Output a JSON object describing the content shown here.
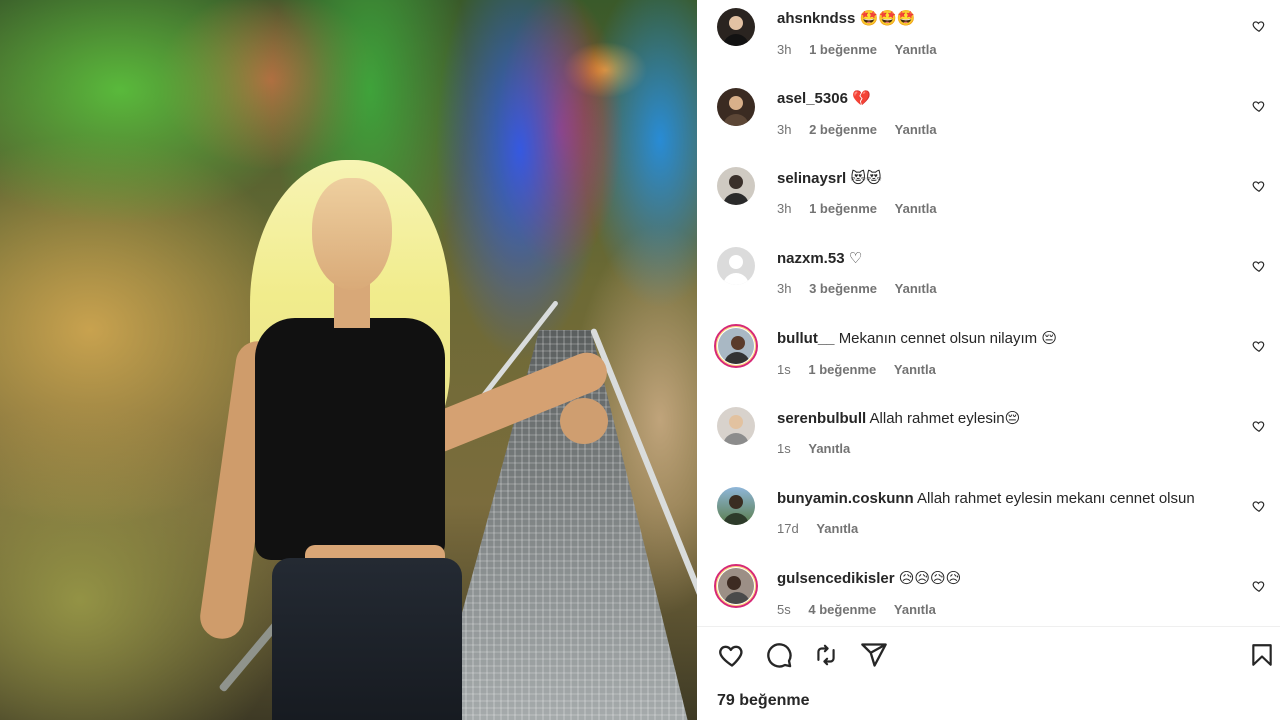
{
  "post": {
    "likes_label": "79 beğenme"
  },
  "comments": [
    {
      "username": "ahsnkndss",
      "text": "",
      "emoji": "🤩🤩🤩",
      "time": "3h",
      "likes": "1 beğenme",
      "reply": "Yanıtla"
    },
    {
      "username": "asel_5306",
      "text": "",
      "emoji": "💔",
      "time": "3h",
      "likes": "2 beğenme",
      "reply": "Yanıtla"
    },
    {
      "username": "selinaysrl",
      "text": "",
      "emoji": "😻😻",
      "time": "3h",
      "likes": "1 beğenme",
      "reply": "Yanıtla"
    },
    {
      "username": "nazxm.53",
      "text": "",
      "emoji": "♡",
      "time": "3h",
      "likes": "3 beğenme",
      "reply": "Yanıtla"
    },
    {
      "username": "bullut__",
      "text": "Mekanın cennet olsun nilayım",
      "emoji": "😔",
      "time": "1s",
      "likes": "1 beğenme",
      "reply": "Yanıtla"
    },
    {
      "username": "serenbulbull",
      "text": "Allah rahmet eylesin",
      "emoji": "😔",
      "time": "1s",
      "likes": "",
      "reply": "Yanıtla"
    },
    {
      "username": "bunyamin.coskunn",
      "text": "Allah rahmet eylesin mekanı cennet olsun",
      "emoji": "",
      "time": "17d",
      "likes": "",
      "reply": "Yanıtla"
    },
    {
      "username": "gulsencedikisler",
      "text": "",
      "emoji": "😥😥😥😥",
      "time": "5s",
      "likes": "4 beğenme",
      "reply": "Yanıtla"
    }
  ],
  "icons": {
    "like": "heart-icon",
    "comment": "comment-icon",
    "repost": "repost-icon",
    "share": "share-icon",
    "save": "bookmark-icon",
    "comment_like": "small-heart-icon"
  },
  "colors": {
    "text": "#262626",
    "meta": "#737373",
    "story_ring": "#d62976",
    "heart_broken": "#e0245e"
  }
}
